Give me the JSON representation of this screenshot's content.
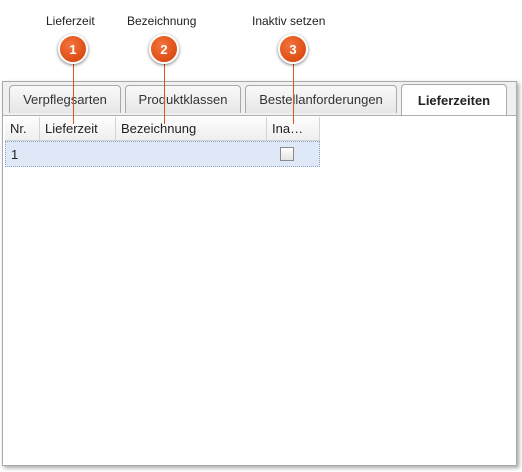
{
  "callouts": [
    {
      "number": "1",
      "label": "Lieferzeit"
    },
    {
      "number": "2",
      "label": "Bezeichnung"
    },
    {
      "number": "3",
      "label": "Inaktiv setzen"
    }
  ],
  "tabs": [
    {
      "label": "Verpflegsarten",
      "active": false
    },
    {
      "label": "Produktklassen",
      "active": false
    },
    {
      "label": "Bestellanforderungen",
      "active": false
    },
    {
      "label": "Lieferzeiten",
      "active": true
    }
  ],
  "grid": {
    "columns": [
      "Nr.",
      "Lieferzeit",
      "Bezeichnung",
      "Ina…"
    ],
    "rows": [
      {
        "nr": "1",
        "lieferzeit": "",
        "bezeichnung": "",
        "inaktiv": false
      }
    ]
  },
  "colors": {
    "callout": "#e0531a",
    "selection": "#dfe8f6"
  }
}
